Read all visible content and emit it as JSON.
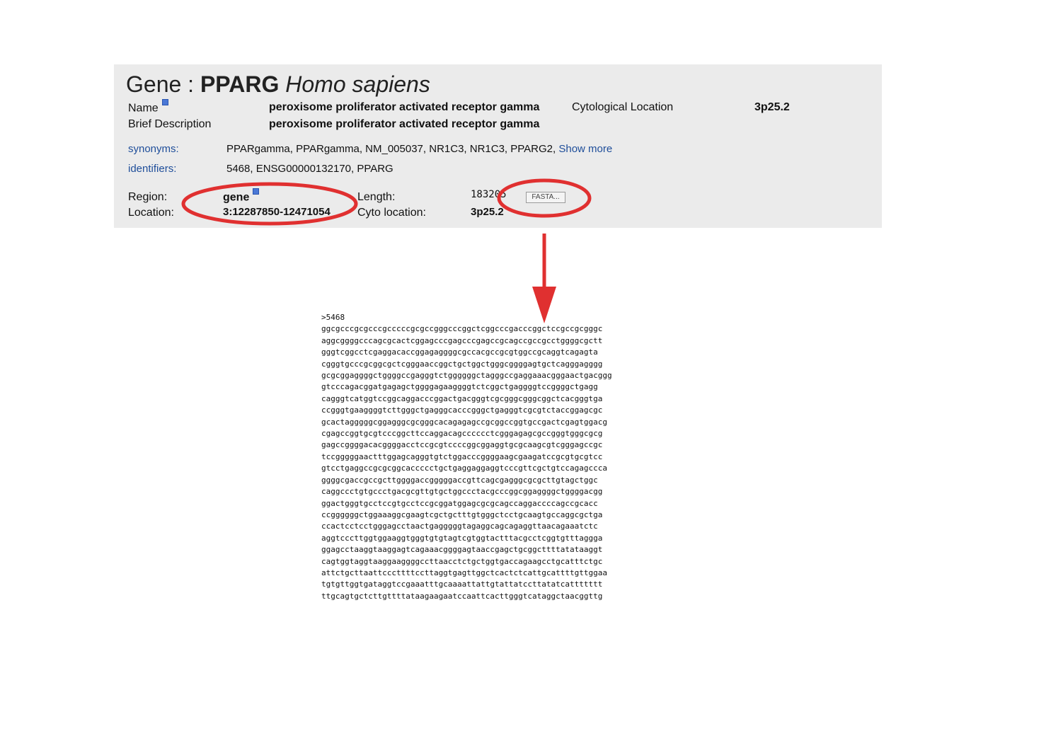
{
  "gene": {
    "title_prefix": "Gene : ",
    "symbol": "PPARG",
    "species": "Homo sapiens",
    "name_label": "Name",
    "name_value": "peroxisome proliferator activated receptor gamma",
    "cyto_label": "Cytological Location",
    "cyto_value": "3p25.2",
    "brief_label": "Brief Description",
    "brief_value": "peroxisome proliferator activated receptor gamma",
    "synonyms_label": "synonyms:",
    "synonyms_value": "PPARgamma, PPARgamma, NM_005037, NR1C3, NR1C3, PPARG2,",
    "show_more": "Show more",
    "identifiers_label": "identifiers:",
    "identifiers_value": "5468, ENSG00000132170, PPARG",
    "region_label": "Region:",
    "region_value": "gene",
    "location_label": "Location:",
    "location_value": "3:12287850-12471054",
    "length_label": "Length:",
    "length_value": "183205",
    "cyto_location_label": "Cyto location:",
    "cyto_location_value": "3p25.2",
    "fasta_button": "FASTA..."
  },
  "annotation_colors": {
    "ellipse": "#e03030",
    "arrow": "#e03030"
  },
  "fasta": {
    "header": ">5468",
    "lines": [
      "ggcgcccgcgcccgcccccgcgccgggcccggctcggcccgacccggctccgccgcgggc",
      "aggcggggcccagcgcactcggagcccgagcccgagccgcagccgccgcctggggcgctt",
      "gggtcggcctcgaggacaccggagaggggcgccacgccgcgtggccgcaggtcagagta",
      "cgggtgcccgcggcgctcgggaaccggctgctggctgggcggggagtgctcagggagggg",
      "gcgcggaggggctggggccgagggtctggggggctagggccgaggaaacgggaactgacggg",
      "gtcccagacggatgagagctggggagaaggggtctcggctgaggggtccggggctgagg",
      "cagggtcatggtccggcaggacccggactgacgggtcgcgggcgggcggctcacgggtga",
      "ccgggtgaaggggtcttgggctgagggcacccgggctgagggtcgcgtctaccggagcgc",
      "gcactagggggcggagggcgcgggcacagagagccgcggccggtgccgactcgagtggacg",
      "cgagccggtgcgtcccggcttccaggacagcccccctcgggagagcgccgggtgggcgcg",
      "gagccggggacacggggacctccgcgtccccggcggaggtgcgcaagcgtcgggagccgc",
      "tccgggggaactttggagcagggtgtctggacccggggaagcgaagatccgcgtgcgtcc",
      "gtcctgaggccgcgcggcaccccctgctgaggaggaggtcccgttcgctgtccagagccca",
      "ggggcgaccgccgcttggggaccgggggaccgttcagcgagggcgcgcttgtagctggc",
      "caggccctgtgccctgacgcgttgtgctggccctacgcccggcggaggggctggggacgg",
      "ggactgggtgcctccgtgcctccgcggatggagcgcgcagccaggaccccagccgcacc",
      "ccggggggctggaaaggcgaagtcgctgctttgtgggctcctgcaagtgccaggcgctga",
      "ccactcctcctgggagcctaactgagggggtagaggcagcagaggttaacagaaatctc",
      "aggtcccttggtggaaggtgggtgtgtagtcgtggtactttacgcctcggtgtttaggga",
      "ggagcctaaggtaaggagtcagaaacggggagtaaccgagctgcggcttttatataaggt",
      "cagtggtaggtaaggaaggggccttaacctctgctggtgaccagaagcctgcatttctgc",
      "attctgcttaattcccttttccttaggtgagttggctcactctcattgcattttgttggaa",
      "tgtgttggtgataggtccgaaatttgcaaaattattgtattatccttatatcattttttt",
      "ttgcagtgctcttgttttataagaagaatccaattcacttgggtcataggctaacggttg"
    ]
  }
}
